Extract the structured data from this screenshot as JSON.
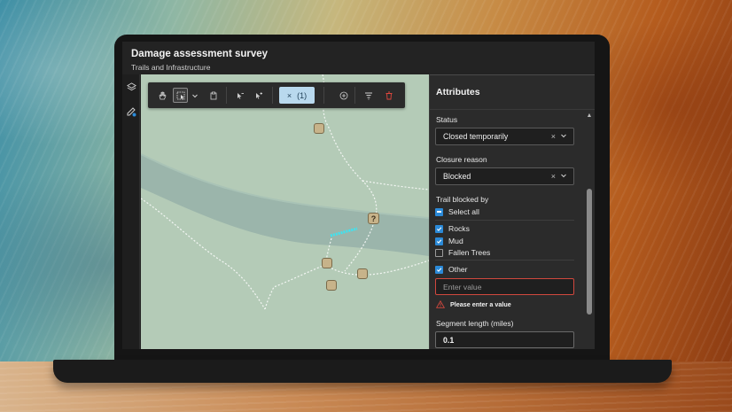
{
  "app": {
    "title": "Damage assessment survey",
    "subtitle": "Trails and Infrastructure"
  },
  "sidebar": {
    "items": [
      {
        "icon": "layers-icon"
      },
      {
        "icon": "edit-icon"
      }
    ]
  },
  "toolbar": {
    "buttons": [
      {
        "icon": "pan-hand-icon"
      },
      {
        "icon": "rectangle-select-icon"
      },
      {
        "icon": "chevron-down-icon"
      },
      {
        "icon": "clipboard-icon"
      },
      {
        "icon": "select-subtract-icon"
      },
      {
        "icon": "select-add-icon"
      },
      {
        "icon": "add-circle-icon"
      },
      {
        "icon": "filter-icon"
      },
      {
        "icon": "trash-icon"
      }
    ],
    "selection_clear": "×",
    "selection_count": "(1)",
    "delete_color": "#e0473d",
    "active_color": "#b9d9ee"
  },
  "map": {
    "markers": [
      {
        "icon": "trail-sign-icon"
      },
      {
        "icon": "question-mark-icon",
        "label": "?"
      },
      {
        "icon": "trail-sign-icon"
      },
      {
        "icon": "hiker-icon"
      },
      {
        "icon": "bridge-icon"
      },
      {
        "icon": "trail-sign-icon"
      }
    ],
    "highlight_color": "#3fe3f0"
  },
  "panel": {
    "title": "Attributes",
    "status": {
      "label": "Status",
      "value": "Closed temporarily"
    },
    "closure_reason": {
      "label": "Closure reason",
      "value": "Blocked"
    },
    "trail_blocked_by": {
      "label": "Trail blocked by",
      "select_all": "Select all",
      "options": [
        {
          "label": "Rocks",
          "checked": true
        },
        {
          "label": "Mud",
          "checked": true
        },
        {
          "label": "Fallen Trees",
          "checked": false
        }
      ],
      "other": {
        "label": "Other",
        "checked": true
      },
      "other_placeholder": "Enter value",
      "error": "Please enter a value"
    },
    "segment_length": {
      "label": "Segment length (miles)",
      "value": "0.1"
    },
    "clear_symbol": "×",
    "accent": "#2b8ad8",
    "error_color": "#d1483e"
  }
}
